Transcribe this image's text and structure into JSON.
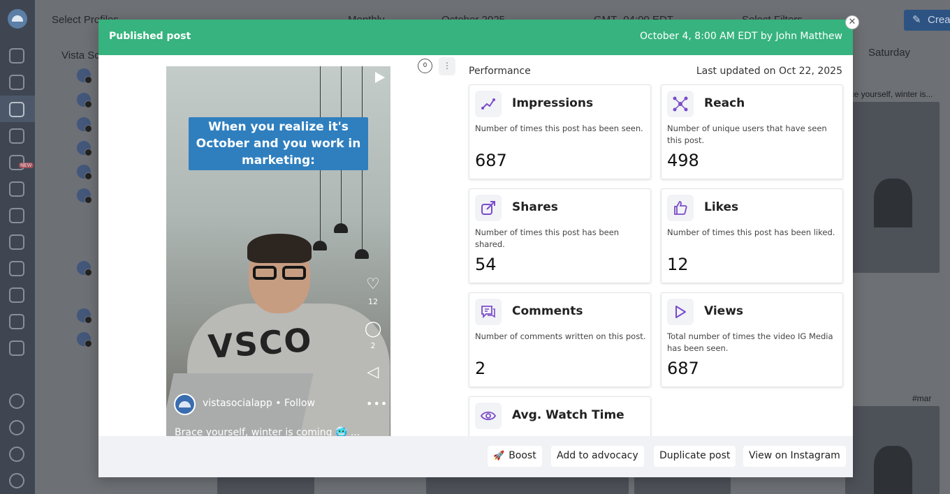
{
  "background": {
    "select_profiles": "Select Profiles",
    "month_view": "Monthly",
    "current_month": "October 2025",
    "timezone": "GMT -04:00 EDT",
    "select_filters": "Select Filters",
    "create_label": "Create",
    "group_name": "Vista So",
    "saturday": "Saturday",
    "post_caption_top": "ace yourself, winter is...",
    "post_caption_bottom": "#mar"
  },
  "sidebar": {
    "new_badge": "NEW"
  },
  "modal": {
    "title": "Published post",
    "meta": "October 4, 8:00 AM EDT by John Matthew",
    "close_icon": "close-icon"
  },
  "preview": {
    "banner": "When you realize it's October and you work in marketing:",
    "sweater_text": "VSCO",
    "likes": "12",
    "comments": "2",
    "account": "vistasocialapp",
    "follow": "• Follow",
    "caption": "Brace yourself, winter is coming 🥶 ..."
  },
  "toolbar": {
    "counter": "0",
    "more": "⋮"
  },
  "performance": {
    "label": "Performance",
    "updated": "Last updated on Oct 22, 2025",
    "metrics": [
      {
        "title": "Impressions",
        "desc": "Number of times this post has been seen.",
        "value": "687",
        "icon": "impressions-icon"
      },
      {
        "title": "Reach",
        "desc": "Number of unique users that have seen this post.",
        "value": "498",
        "icon": "reach-icon"
      },
      {
        "title": "Shares",
        "desc": "Number of times this post has been shared.",
        "value": "54",
        "icon": "shares-icon"
      },
      {
        "title": "Likes",
        "desc": "Number of times this post has been liked.",
        "value": "12",
        "icon": "thumbs-up-icon"
      },
      {
        "title": "Comments",
        "desc": "Number of comments written on this post.",
        "value": "2",
        "icon": "comments-icon"
      },
      {
        "title": "Views",
        "desc": "Total number of times the video IG Media has been seen.",
        "value": "687",
        "icon": "play-icon"
      },
      {
        "title": "Avg. Watch Time",
        "desc": "",
        "value": "",
        "icon": "eye-icon"
      }
    ],
    "colors": {
      "icon_accent": "#7b4bc9",
      "header_green": "#36b37e"
    }
  },
  "footer": {
    "boost": "Boost",
    "advocacy": "Add to advocacy",
    "duplicate": "Duplicate post",
    "view_instagram": "View on Instagram"
  }
}
